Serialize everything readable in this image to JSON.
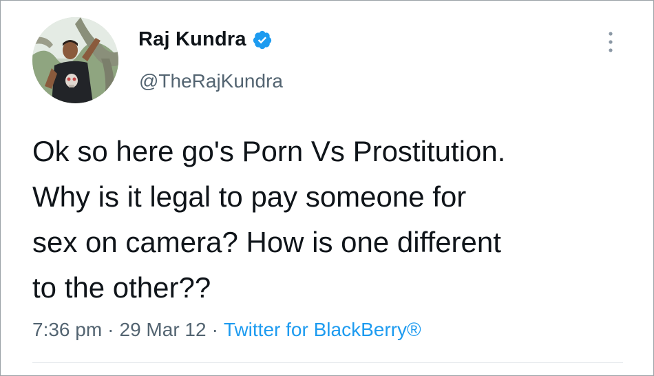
{
  "tweet": {
    "author": {
      "display_name": "Raj Kundra",
      "handle": "@TheRajKundra",
      "verified": true,
      "avatar_icon": "profile-photo"
    },
    "text_lines": [
      "Ok so here go's Porn Vs Prostitution.",
      "Why is it legal to pay someone for",
      "sex on camera? How is one different",
      "to the other??"
    ],
    "time": "7:36 pm",
    "separator": "·",
    "date": "29 Mar 12",
    "source": "Twitter for BlackBerry®",
    "more_icon": "vertical-ellipsis-icon"
  },
  "colors": {
    "verified_blue": "#1d9bf0",
    "link_blue": "#1d9bf0",
    "text_primary": "#0f1419",
    "text_secondary": "#536471"
  }
}
